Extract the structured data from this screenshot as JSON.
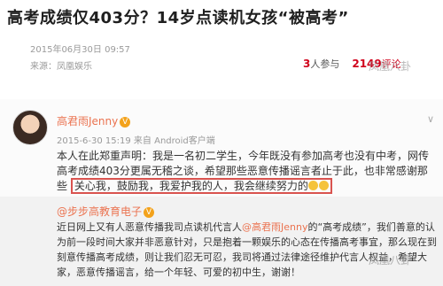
{
  "article": {
    "title": "高考成绩仅403分？14岁点读机女孩“被高考”",
    "date": "2015年06月30日 09:57",
    "source": "来源：凤凰娱乐",
    "participants_count": "3",
    "participants_suffix": "人参与",
    "comments_count": "2149",
    "comments_suffix": "评论",
    "watermark": "凤凰八卦"
  },
  "post": {
    "username": "高君雨Jenny",
    "badge": "V",
    "timestamp": "2015-6-30 15:19 来自 Android客户端",
    "chevron": "∨",
    "body_main": "本人在此郑重声明：我是一名初二学生，今年既没有参加高考也没有中考，网传高考成绩403分更属无稽之谈，希望那些恶意传播谣言者止于此，也非常感谢那些",
    "body_highlight": "关心我，鼓励我，我爱护我的人，我会继续努力的"
  },
  "repost": {
    "username": "@步步高教育电子",
    "badge": "V",
    "text_1": "近日网上又有人恶意传播我司点读机代言人",
    "mention": "@高君雨Jenny",
    "text_2": "的“高考成绩”，我们善意的认为前一段时间大家并非恶意针对，只是抱着一颗娱乐的心态在传播高考事宜，那么现在到刻意传播高考成绩，则让我们忍无可忍，我司将通过法律途径维护代言人权益，希望大家，恶意传播谣言，给一个年轻、可爱的初中生，谢谢！"
  }
}
